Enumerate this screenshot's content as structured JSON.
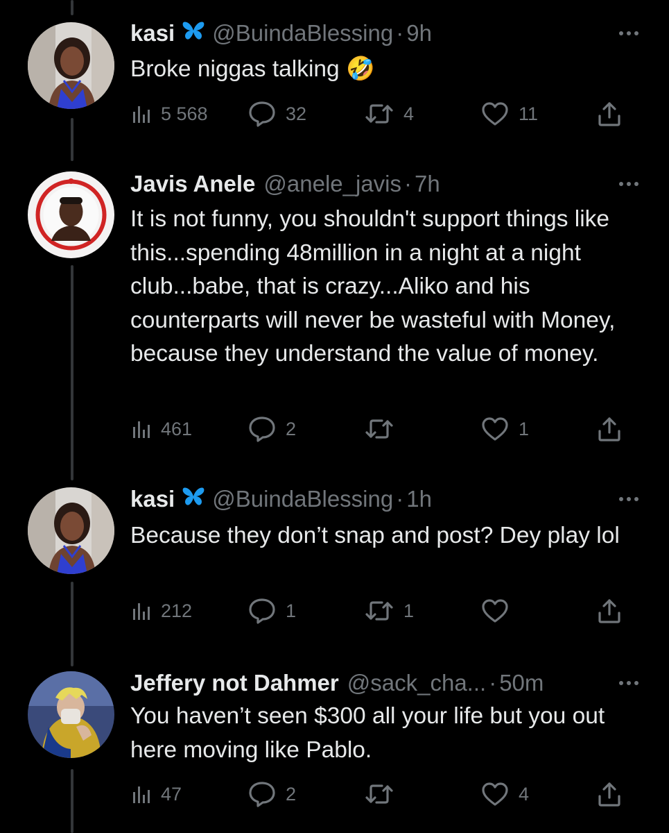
{
  "tweets": [
    {
      "name": "kasi",
      "handle": "@BuindaBlessing",
      "time": "9h",
      "text": "Broke niggas talking 🤣",
      "views": "5 568",
      "replies": "32",
      "retweets": "4",
      "likes": "11"
    },
    {
      "name": "Javis Anele",
      "handle": "@anele_javis",
      "time": "7h",
      "text": "It is not funny, you shouldn't support things like this...spending 48million in a night at a night club...babe, that is crazy...Aliko and his counterparts will never be wasteful with Money, because they understand the value of money.",
      "views": "461",
      "replies": "2",
      "retweets": "",
      "likes": "1"
    },
    {
      "name": "kasi",
      "handle": "@BuindaBlessing",
      "time": "1h",
      "text": "Because they don’t snap and post? Dey play lol",
      "views": "212",
      "replies": "1",
      "retweets": "1",
      "likes": ""
    },
    {
      "name": "Jeffery not Dahmer",
      "handle": "@sack_cha...",
      "time": "50m",
      "text": "You haven’t seen $300 all your life but you out here moving like Pablo.",
      "views": "47",
      "replies": "2",
      "retweets": "",
      "likes": "4"
    }
  ],
  "separator": "·",
  "colors": {
    "background": "#000000",
    "text": "#e7e9ea",
    "muted": "#71767b",
    "thread_line": "#333639",
    "verified_butterfly": "#1d9bf0"
  },
  "icons": [
    "views-icon",
    "reply-icon",
    "retweet-icon",
    "like-icon",
    "share-icon",
    "more-icon",
    "butterfly-icon"
  ]
}
